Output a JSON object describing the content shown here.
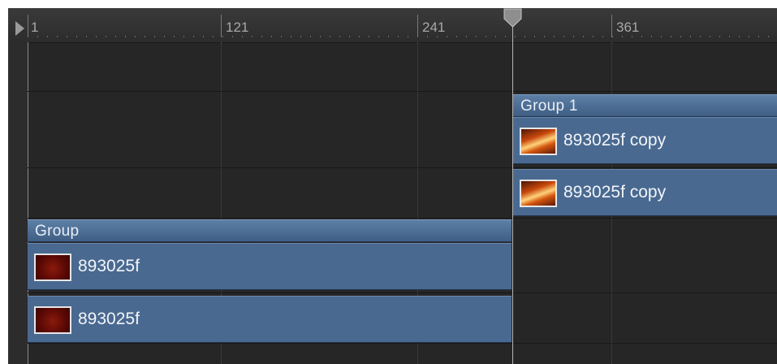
{
  "ruler": {
    "ticks": [
      "1",
      "121",
      "241",
      "361"
    ]
  },
  "timeline": {
    "groups": [
      {
        "name": "Group",
        "layers": [
          {
            "name": "893025f",
            "thumbnail": "dark-red-image"
          },
          {
            "name": "893025f",
            "thumbnail": "dark-red-image"
          }
        ]
      },
      {
        "name": "Group 1",
        "layers": [
          {
            "name": "893025f copy",
            "thumbnail": "fire-image"
          },
          {
            "name": "893025f copy",
            "thumbnail": "fire-image"
          }
        ]
      }
    ]
  },
  "colors": {
    "background": "#262626",
    "group_header": "#4e6f97",
    "layer_bar": "#496990",
    "playhead": "#b5b5b5"
  }
}
